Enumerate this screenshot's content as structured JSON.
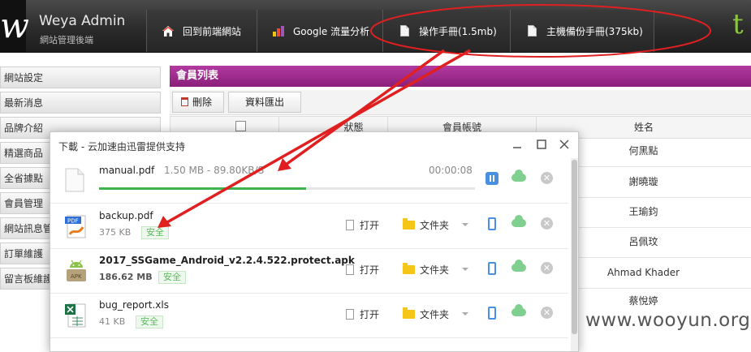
{
  "header": {
    "brand_title": "Weya Admin",
    "brand_subtitle": "網站管理後端",
    "right_letter": "t",
    "nav": [
      {
        "label": "回到前端網站",
        "icon": "home-icon"
      },
      {
        "label": "Google 流量分析",
        "icon": "bar-chart-icon"
      },
      {
        "label": "操作手冊(1.5mb)",
        "icon": "document-icon"
      },
      {
        "label": "主機備份手冊(375kb)",
        "icon": "document-icon"
      }
    ]
  },
  "sidebar": {
    "items": [
      {
        "label": "網站設定"
      },
      {
        "label": "最新消息"
      },
      {
        "label": "品牌介紹"
      },
      {
        "label": "精選商品"
      },
      {
        "label": "全省據點"
      },
      {
        "label": "會員管理"
      },
      {
        "label": "網站訊息管"
      },
      {
        "label": "訂單維護"
      },
      {
        "label": "留言板維護"
      }
    ]
  },
  "main": {
    "panel_title": "會員列表",
    "delete_label": "刪除",
    "export_label": "資料匯出",
    "columns": {
      "status": "狀態",
      "account": "會員帳號",
      "name": "姓名"
    },
    "names": [
      "何黑點",
      "謝曉璇",
      "王瑜鈞",
      "呂佩玟",
      "Ahmad Khader",
      "蔡悅婷"
    ]
  },
  "dialog": {
    "title": "下載 - 云加速由迅雷提供支持",
    "safe_label": "安全",
    "open_label": "打开",
    "folder_label": "文件夹",
    "downloads": [
      {
        "name": "manual.pdf",
        "progress_text": "1.50 MB - 89.80KB/S",
        "elapsed": "00:00:08",
        "progress": 0.55,
        "state": "downloading"
      },
      {
        "name": "backup.pdf",
        "size": "375 KB",
        "icon": "pdf-icon"
      },
      {
        "name": "2017_SSGame_Android_v2.2.4.522.protect.apk",
        "size": "186.62 MB",
        "icon": "apk-android-icon"
      },
      {
        "name": "bug_report.xls",
        "size": "41 KB",
        "icon": "excel-icon"
      }
    ]
  },
  "watermark": "www.wooyun.org",
  "colors": {
    "accent_purple": "#9b2a8b",
    "annotation_red": "#e02020",
    "progress_green": "#3fb34f",
    "safe_green": "#5cb85c"
  }
}
